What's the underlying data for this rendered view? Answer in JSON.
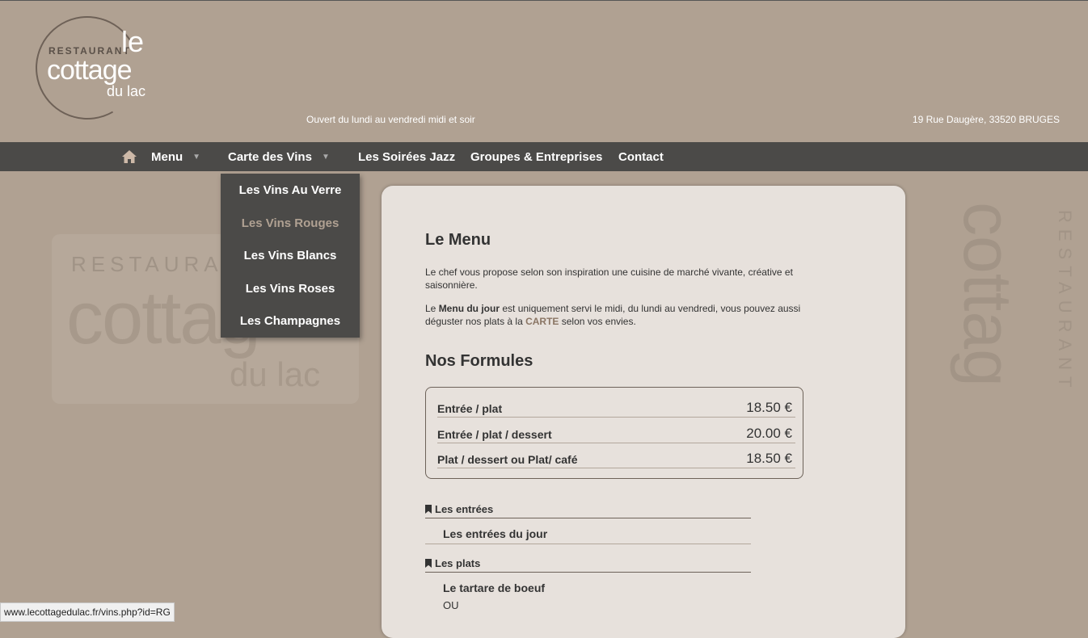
{
  "header": {
    "logo": {
      "restaurant": "RESTAURANT",
      "le": "le",
      "cottage": "cottage",
      "dulac": "du lac"
    },
    "hours": "Ouvert du lundi au vendredi midi et soir",
    "address": "19 Rue Daugère, 33520 BRUGES"
  },
  "nav": {
    "home_icon": "home-icon",
    "items": [
      {
        "label": "Menu",
        "caret": "▼"
      },
      {
        "label": "Carte des Vins",
        "caret": "▼"
      },
      {
        "label": "Les Soirées Jazz"
      },
      {
        "label": "Groupes & Entreprises"
      },
      {
        "label": "Contact"
      }
    ],
    "dropdown": [
      {
        "label": "Les Vins Au Verre"
      },
      {
        "label": "Les Vins Rouges"
      },
      {
        "label": "Les Vins Blancs"
      },
      {
        "label": "Les Vins Roses"
      },
      {
        "label": "Les Champagnes"
      }
    ]
  },
  "content": {
    "title": "Le Menu",
    "intro": "Le chef vous propose selon son inspiration une cuisine de marché vivante, créative et saisonnière.",
    "para2_prefix": "Le ",
    "para2_bold": "Menu du jour",
    "para2_mid": " est uniquement servi le midi, du lundi au vendredi, vous pouvez aussi déguster nos plats à la ",
    "para2_link": "CARTE",
    "para2_suffix": " selon vos envies.",
    "formules_title": "Nos Formules",
    "formules": [
      {
        "name": "Entrée / plat",
        "price": "18.50 €"
      },
      {
        "name": "Entrée / plat / dessert",
        "price": "20.00 €"
      },
      {
        "name": "Plat / dessert ou Plat/ café",
        "price": "18.50 €"
      }
    ],
    "sections": [
      {
        "title": "Les entrées",
        "items": [
          "Les entrées du jour"
        ]
      },
      {
        "title": "Les plats",
        "items": [
          "Le tartare de boeuf",
          "OU"
        ]
      }
    ]
  },
  "watermark": {
    "restaurant": "RESTAURANT",
    "cottage": "cottag",
    "dulac": "du lac"
  },
  "status_url": "www.lecottagedulac.fr/vins.php?id=RG"
}
